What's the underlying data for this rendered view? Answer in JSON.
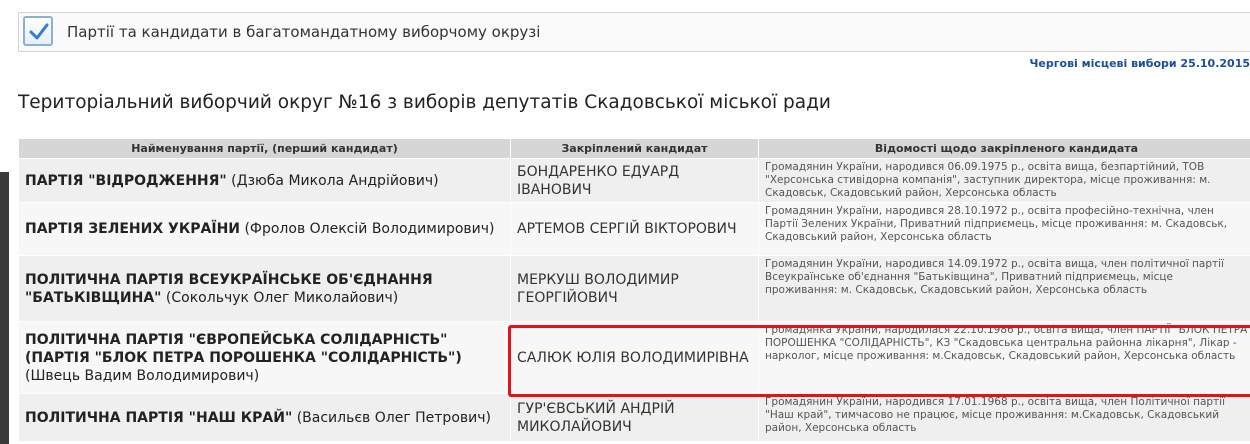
{
  "header": {
    "title": "Партії та кандидати в багатомандатному виборчому окрузі",
    "election_link": "Чергові місцеві вибори 25.10.2015"
  },
  "page_title": "Територіальний виборчий округ №16 з виборів депутатів Скадовської міської ради",
  "table": {
    "columns": [
      "Найменування партії, (перший кандидат)",
      "Закріплений кандидат",
      "Відомості щодо закріпленого кандидата"
    ],
    "rows": [
      {
        "party": "ПАРТІЯ \"ВІДРОДЖЕННЯ\"",
        "first_candidate": "(Дзюба Микола Андрійович)",
        "candidate": "БОНДАРЕНКО ЕДУАРД ІВАНОВИЧ",
        "info": "Громадянин України, народився 06.09.1975 р., освіта вища, безпартійний, ТОВ \"Херсонська стивідорна компанія\", заступник директора, місце проживання: м. Скадовськ, Скадовський район, Херсонська область"
      },
      {
        "party": "ПАРТІЯ ЗЕЛЕНИХ УКРАЇНИ",
        "first_candidate": "(Фролов Олексій Володимирович)",
        "candidate": "АРТЕМОВ СЕРГІЙ ВІКТОРОВИЧ",
        "info": "Громадянин України, народився 28.10.1972 р., освіта професійно-технічна, член Партії Зелених України, Приватний підприємець, місце проживання: м. Скадовськ, Скадовський район, Херсонська область"
      },
      {
        "party": "ПОЛІТИЧНА ПАРТІЯ ВСЕУКРАЇНСЬКЕ ОБ'ЄДНАННЯ \"БАТЬКІВЩИНА\"",
        "first_candidate": "(Сокольчук Олег Миколайович)",
        "candidate": "МЕРКУШ ВОЛОДИМИР ГЕОРГІЙОВИЧ",
        "info": "Громадянин України, народився 14.09.1972 р., освіта вища, член політичної партії Всеукраїнське об'єднання \"Батьківщина\", Приватний підприємець, місце проживання: м. Скадовськ, Скадовський район, Херсонська область"
      },
      {
        "party": "ПОЛІТИЧНА ПАРТІЯ \"ЄВРОПЕЙСЬКА СОЛІДАРНІСТЬ\" (ПАРТІЯ \"БЛОК ПЕТРА ПОРОШЕНКА \"СОЛІДАРНІСТЬ\")",
        "first_candidate": "(Швець Вадим Володимирович)",
        "candidate": "САЛЮК ЮЛІЯ ВОЛОДИМИРІВНА",
        "info": "Громадянка України, народилася 22.10.1986 р., освіта вища, член ПАРТІЇ \"БЛОК ПЕТРА ПОРОШЕНКА \"СОЛІДАРНІСТЬ\", КЗ \"Скадовська центральна районна лікарня\", Лікар - нарколог, місце проживання: м.Скадовськ, Скадовський район, Херсонська область"
      },
      {
        "party": "ПОЛІТИЧНА ПАРТІЯ \"НАШ КРАЙ\"",
        "first_candidate": "(Васильєв Олег Петрович)",
        "candidate": "ГУР'ЄВСЬКИЙ АНДРІЙ МИКОЛАЙОВИЧ",
        "info": "Громадянин України, народився 17.01.1968 р., освіта вища, член Політичної партії \"Наш край\", тимчасово не працює, місце проживання: м.Скадовськ, Скадовський район, Херсонська область"
      }
    ]
  },
  "colors": {
    "highlight": "#e0151b",
    "link": "#1a4f9a",
    "header_bg": "#d6d6d6"
  },
  "icons": {
    "header_checkbox": "checkmark-icon"
  }
}
